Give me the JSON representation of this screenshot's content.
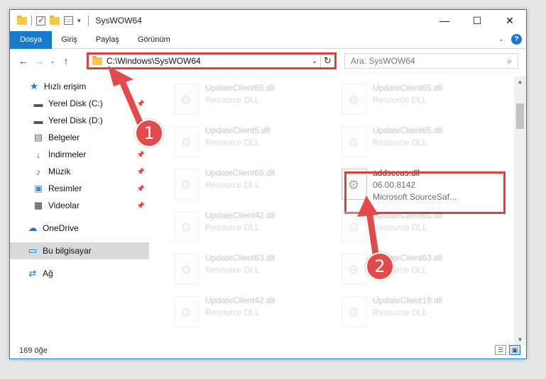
{
  "window": {
    "title": "SysWOW64",
    "controls": {
      "minimize": "—",
      "maximize": "☐",
      "close": "✕"
    }
  },
  "ribbon": {
    "tabs": [
      "Dosya",
      "Giriş",
      "Paylaş",
      "Görünüm"
    ],
    "expand_icon": "chevron-down-icon",
    "help_label": "?"
  },
  "nav": {
    "back": "←",
    "forward": "→",
    "recent": "⌄",
    "up": "↑",
    "address": "C:\\Windows\\SysWOW64",
    "search_placeholder": "Ara: SysWOW64"
  },
  "sidebar": {
    "items": [
      {
        "label": "Hızlı erişim",
        "icon": "star-icon",
        "pinned": false
      },
      {
        "label": "Yerel Disk (C:)",
        "icon": "drive-icon",
        "pinned": true
      },
      {
        "label": "Yerel Disk (D:)",
        "icon": "drive-icon",
        "pinned": false
      },
      {
        "label": "Belgeler",
        "icon": "documents-icon",
        "pinned": true
      },
      {
        "label": "İndirmeler",
        "icon": "download-icon",
        "pinned": true
      },
      {
        "label": "Müzik",
        "icon": "music-icon",
        "pinned": true
      },
      {
        "label": "Resimler",
        "icon": "pictures-icon",
        "pinned": true
      },
      {
        "label": "Videolar",
        "icon": "videos-icon",
        "pinned": true
      },
      {
        "label": "OneDrive",
        "icon": "cloud-icon",
        "pinned": false
      },
      {
        "label": "Bu bilgisayar",
        "icon": "computer-icon",
        "pinned": false,
        "selected": true
      },
      {
        "label": "Ağ",
        "icon": "network-icon",
        "pinned": false
      }
    ]
  },
  "files": {
    "left_column": [
      {
        "name": "UpdateClient65.dll",
        "type": "Resource DLL"
      },
      {
        "name": "UpdateClient5.dll",
        "type": "Resource DLL"
      },
      {
        "name": "UpdateClient65.dll",
        "type": "Resource DLL"
      },
      {
        "name": "UpdateClient42.dll",
        "type": "Resource DLL"
      },
      {
        "name": "UpdateClient63.dll",
        "type": "Resource DLL"
      },
      {
        "name": "UpdateClient42.dll",
        "type": "Resource DLL"
      }
    ],
    "right_column": [
      {
        "name": "UpdateClient65.dll",
        "type": "Resource DLL"
      },
      {
        "name": "UpdateClient65.dll",
        "type": "Resource DLL"
      },
      {
        "name": "addsccus.dll",
        "version": "06.00.8142",
        "company": "Microsoft SourceSaf...",
        "highlighted": true
      },
      {
        "name": "UpdateClient65.dll",
        "type": "Resource DLL"
      },
      {
        "name": "UpdateClient63.dll",
        "type": "Resource DLL"
      },
      {
        "name": "UpdateClient19.dll",
        "type": "Resource DLL"
      }
    ]
  },
  "status": {
    "item_count": "169 öğe"
  },
  "callouts": {
    "step1": "1",
    "step2": "2"
  },
  "colors": {
    "accent": "#1979ca",
    "highlight": "#d9403f"
  }
}
